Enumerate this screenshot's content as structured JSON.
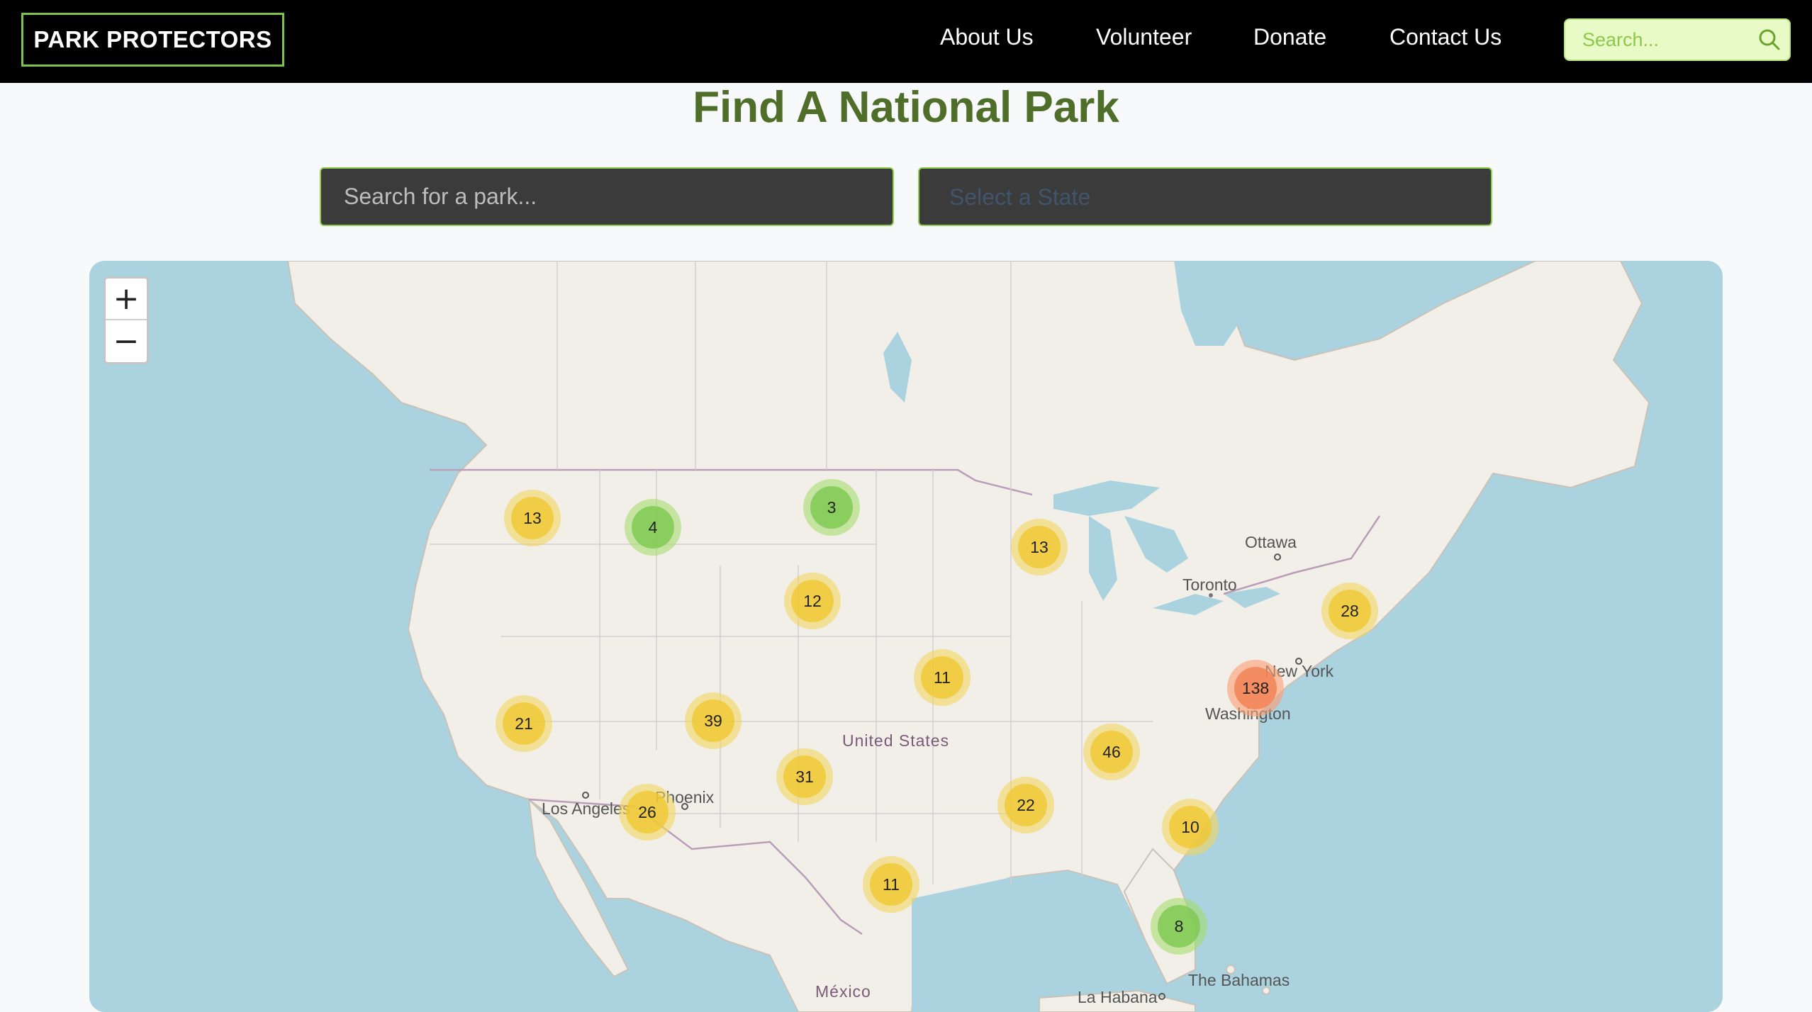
{
  "header": {
    "brand": "PARK PROTECTORS",
    "nav": {
      "about": "About Us",
      "volunteer": "Volunteer",
      "donate": "Donate",
      "contact": "Contact Us"
    },
    "search_placeholder": "Search...",
    "search_icon": "search-icon"
  },
  "page": {
    "title": "Find A National Park"
  },
  "filters": {
    "park_search_placeholder": "Search for a park...",
    "state_placeholder": "Select a State"
  },
  "map": {
    "zoom_in": "+",
    "zoom_out": "−",
    "labels": {
      "ottawa": "Ottawa",
      "toronto": "Toronto",
      "new_york": "New York",
      "washington": "Washington",
      "united_states": "United States",
      "phoenix": "Phoenix",
      "los_angeles": "Los Angeles",
      "mexico": "México",
      "la_habana": "La Habana",
      "bahamas": "The Bahamas"
    },
    "clusters": {
      "c1": "13",
      "c2": "4",
      "c3": "3",
      "c4": "13",
      "c5": "12",
      "c6": "28",
      "c7": "11",
      "c8": "138",
      "c9": "21",
      "c10": "39",
      "c11": "46",
      "c12": "31",
      "c13": "26",
      "c14": "22",
      "c15": "10",
      "c16": "11",
      "c17": "8"
    },
    "cluster_colors": {
      "small": "#7dc850",
      "medium": "#f0c832",
      "large": "#f18050"
    }
  }
}
